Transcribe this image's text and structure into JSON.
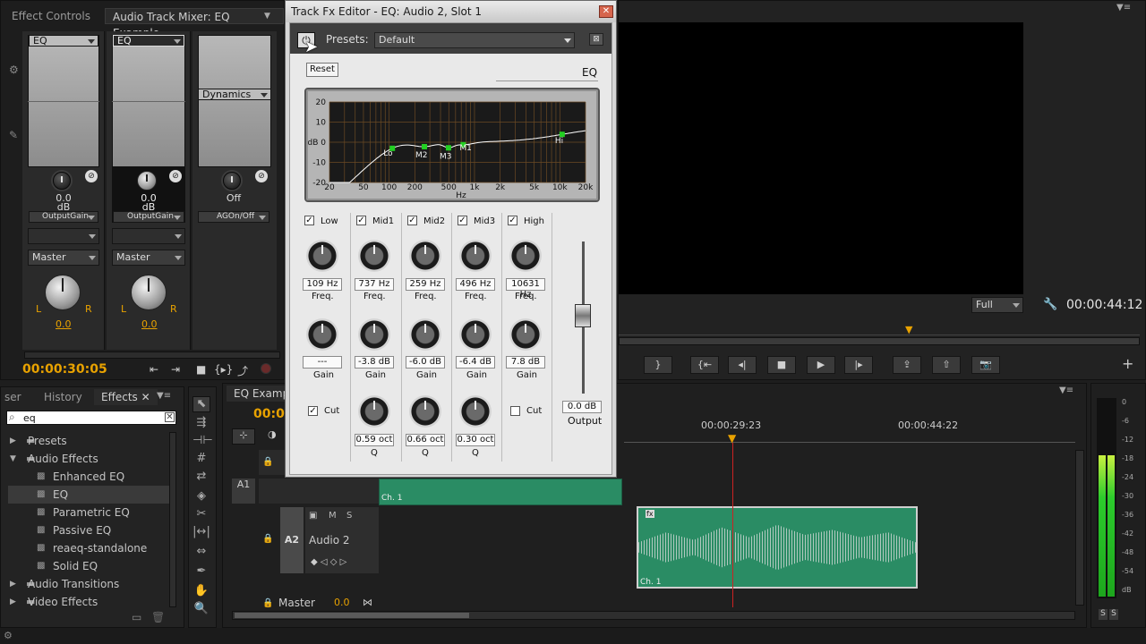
{
  "left_panel": {
    "tabs": [
      "Effect Controls",
      "Audio Track Mixer: EQ Example"
    ],
    "channels": [
      {
        "slot": "EQ",
        "value": "0.0",
        "unit": "dB",
        "param": "OutputGain",
        "output": "Master",
        "pan": "0.0"
      },
      {
        "slot": "EQ",
        "value": "0.0",
        "unit": "dB",
        "param": "OutputGain",
        "output": "Master",
        "pan": "0.0"
      },
      {
        "slot": "Dynamics",
        "value": "Off",
        "unit": "",
        "param": "AGOn/Off"
      }
    ],
    "pan_l": "L",
    "pan_r": "R",
    "timecode": "00:00:30:05"
  },
  "fx_editor": {
    "title": "Track Fx Editor - EQ: Audio 2, Slot 1",
    "presets_label": "Presets:",
    "preset_value": "Default",
    "reset": "Reset",
    "effect_name": "EQ",
    "graph": {
      "y_ticks": [
        "20",
        "10",
        "dB 0",
        "-10",
        "-20"
      ],
      "x_ticks": [
        "20",
        "50",
        "100",
        "200",
        "500",
        "1k",
        "2k",
        "5k",
        "10k",
        "20k"
      ],
      "x_unit": "Hz",
      "point_labels": [
        "Lo",
        "M2",
        "M3",
        "M1",
        "Hi"
      ]
    },
    "bands": [
      {
        "name": "Low",
        "checked": true,
        "freq": "109 Hz",
        "gain": "---",
        "q": null
      },
      {
        "name": "Mid1",
        "checked": true,
        "freq": "737 Hz",
        "gain": "-3.8 dB",
        "q": "0.59 oct"
      },
      {
        "name": "Mid2",
        "checked": true,
        "freq": "259 Hz",
        "gain": "-6.0 dB",
        "q": "0.66 oct"
      },
      {
        "name": "Mid3",
        "checked": true,
        "freq": "496 Hz",
        "gain": "-6.4 dB",
        "q": "0.30 oct"
      },
      {
        "name": "High",
        "checked": true,
        "freq": "10631 Hz",
        "gain": "7.8 dB",
        "q": null
      }
    ],
    "freq_label": "Freq.",
    "gain_label": "Gain",
    "q_label": "Q",
    "cut_label": "Cut",
    "low_cut_checked": true,
    "high_cut_checked": false,
    "output_value": "0.0 dB",
    "output_label": "Output"
  },
  "program_monitor": {
    "zoom": "Full",
    "timecode": "00:00:44:12"
  },
  "effects_panel": {
    "tabs": [
      "ser",
      "History",
      "Effects"
    ],
    "search": "eq",
    "tree": [
      {
        "label": "Presets",
        "level": 0,
        "expanded": false
      },
      {
        "label": "Audio Effects",
        "level": 0,
        "expanded": true
      },
      {
        "label": "Enhanced EQ",
        "level": 1
      },
      {
        "label": "EQ",
        "level": 1
      },
      {
        "label": "Parametric EQ",
        "level": 1
      },
      {
        "label": "Passive EQ",
        "level": 1
      },
      {
        "label": "reaeq-standalone",
        "level": 1
      },
      {
        "label": "Solid EQ",
        "level": 1
      },
      {
        "label": "Audio Transitions",
        "level": 0,
        "expanded": false
      },
      {
        "label": "Video Effects",
        "level": 0,
        "expanded": false
      }
    ]
  },
  "timeline": {
    "tab": "EQ Example",
    "timecode": "00:0",
    "ruler": [
      "00:00:29:23",
      "00:00:44:22"
    ],
    "tracks": [
      {
        "id": "A1",
        "clip": "Ch. 1"
      },
      {
        "id": "A2",
        "name": "Audio 2",
        "clip": "Ch. 1"
      }
    ],
    "track_buttons": [
      "M",
      "S"
    ],
    "master_label": "Master",
    "master_value": "0.0"
  },
  "meter": {
    "scale": [
      "0",
      "-6",
      "-12",
      "-18",
      "-24",
      "-30",
      "-36",
      "-42",
      "-48",
      "-54",
      "dB"
    ],
    "solo": [
      "S",
      "S"
    ],
    "level_l": 0.76,
    "level_r": 0.76
  },
  "colors": {
    "accent": "#e8a200",
    "clip_green": "#2a8c64",
    "eq_point": "#22d022",
    "playhead": "#cc2222"
  }
}
